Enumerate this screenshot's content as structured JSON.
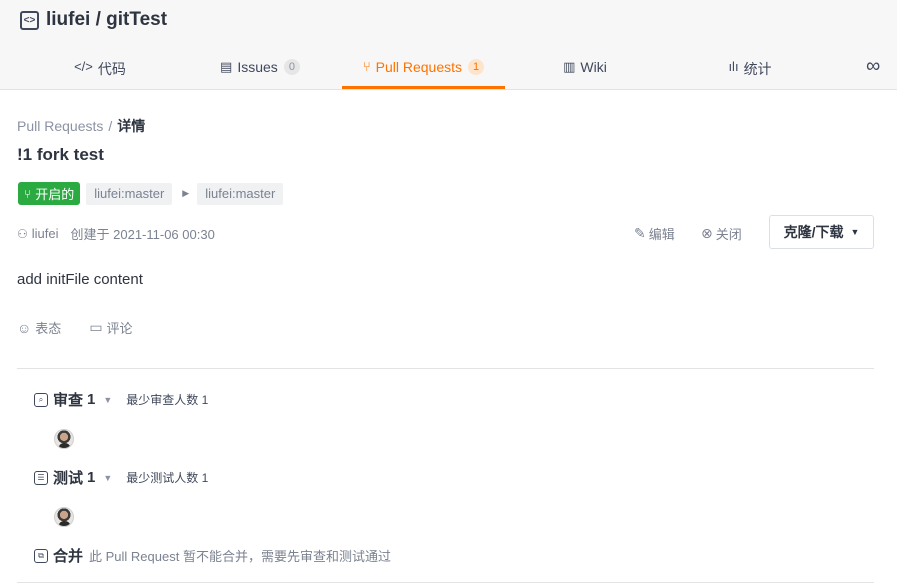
{
  "repo": {
    "title": "liufei / gitTest",
    "icon": "code-box-icon"
  },
  "tabs": {
    "code": {
      "label": "代码",
      "icon": "</>"
    },
    "issues": {
      "label": "Issues",
      "count": "0",
      "icon": "▤"
    },
    "pull_requests": {
      "label": "Pull Requests",
      "count": "1",
      "icon": "⑂"
    },
    "wiki": {
      "label": "Wiki",
      "icon": "▥"
    },
    "stats": {
      "label": "统计",
      "icon": "ılı"
    },
    "more_icon": "∞"
  },
  "breadcrumb": {
    "parent": "Pull Requests",
    "separator": "/",
    "current": "详情"
  },
  "pr": {
    "title": "!1 fork test",
    "status": "开启的",
    "source_branch": "liufei:master",
    "target_branch": "liufei:master",
    "author": "liufei",
    "created": "创建于 2021-11-06 00:30",
    "description": "add initFile content"
  },
  "actions": {
    "edit": "编辑",
    "close": "关闭",
    "clone": "克隆/下载"
  },
  "reactions": {
    "emoji": "表态",
    "comment": "评论"
  },
  "review": {
    "title": "审查",
    "count": "1",
    "note": "最少审查人数 1"
  },
  "test": {
    "title": "测试",
    "count": "1",
    "note": "最少测试人数 1"
  },
  "merge": {
    "title": "合并",
    "note": "此 Pull Request 暂不能合并，需要先审查和测试通过"
  },
  "colors": {
    "accent": "#fe7300",
    "status_open": "#2baa41"
  }
}
